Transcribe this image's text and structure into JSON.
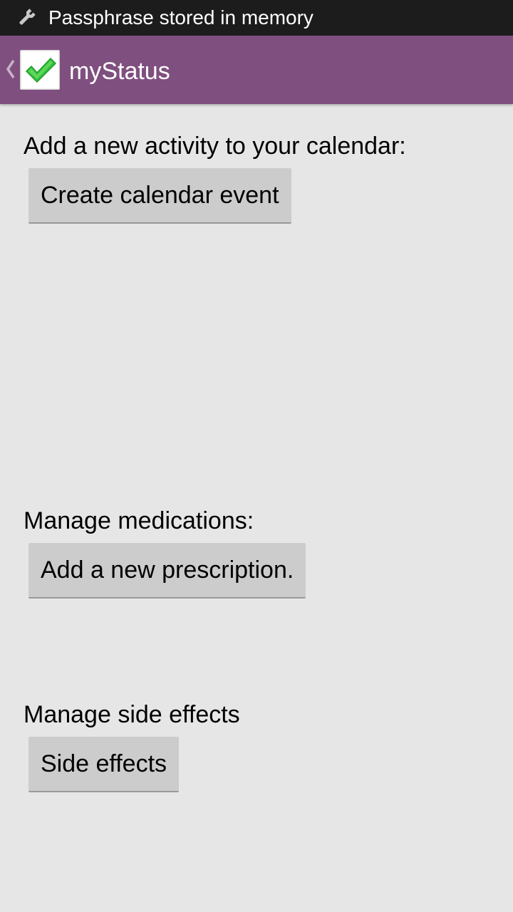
{
  "status_bar": {
    "notification_icon": "wrench-icon",
    "notification_text": "Passphrase stored in memory"
  },
  "action_bar": {
    "up_icon": "chevron-left-icon",
    "app_icon": "checkmark-icon",
    "title": "myStatus",
    "background": "#7f4f7f"
  },
  "sections": {
    "calendar": {
      "label": "Add a new activity to your calendar:",
      "button": "Create calendar event"
    },
    "medications": {
      "label": "Manage medications:",
      "button": "Add a new prescription."
    },
    "side_effects": {
      "label": "Manage side effects",
      "button": "Side effects"
    }
  }
}
